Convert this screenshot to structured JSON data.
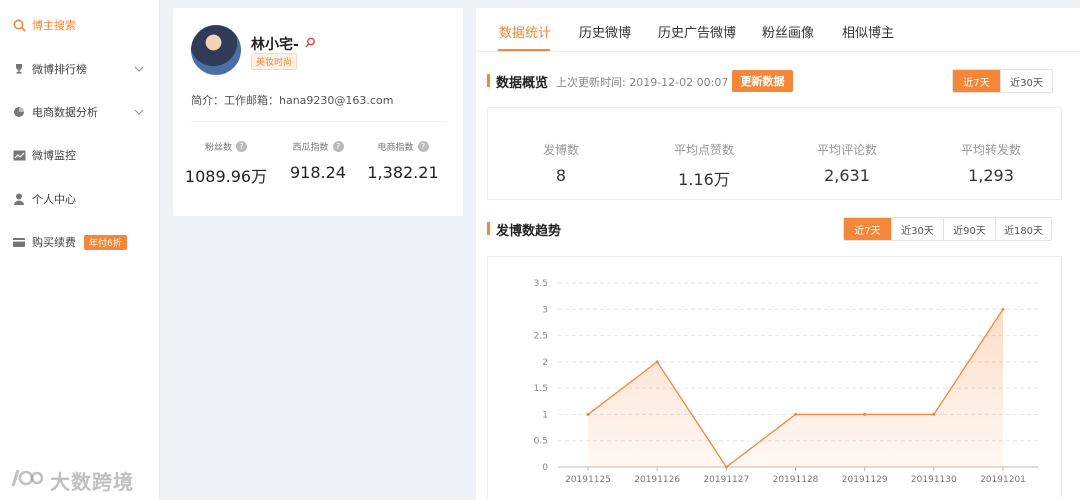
{
  "sidebar": {
    "items": [
      {
        "label": "博主搜索",
        "icon": "search-icon",
        "active": true
      },
      {
        "label": "微博排行榜",
        "icon": "trophy-icon",
        "has_chevron": true
      },
      {
        "label": "电商数据分析",
        "icon": "pie-chart-icon",
        "has_chevron": true
      },
      {
        "label": "微博监控",
        "icon": "monitor-chart-icon"
      },
      {
        "label": "个人中心",
        "icon": "user-icon"
      },
      {
        "label": "购买续费",
        "icon": "card-icon",
        "badge": "年付6折"
      }
    ]
  },
  "watermark": {
    "text": "大数跨境"
  },
  "profile": {
    "name": "林小宅-",
    "tag": "美妆时尚",
    "bio": "简介：工作邮箱：hana9230@163.com",
    "stats": [
      {
        "label": "粉丝数",
        "value": "1089.96万"
      },
      {
        "label": "西瓜指数",
        "value": "918.24"
      },
      {
        "label": "电商指数",
        "value": "1,382.21"
      }
    ]
  },
  "tabs": [
    "数据统计",
    "历史微博",
    "历史广告微博",
    "粉丝画像",
    "相似博主"
  ],
  "overview": {
    "title": "数据概览",
    "updated_label": "上次更新时间: 2019-12-02 00:07",
    "update_button": "更新数据",
    "ranges": [
      "近7天",
      "近30天"
    ],
    "stats": [
      {
        "label": "发博数",
        "value": "8"
      },
      {
        "label": "平均点赞数",
        "value": "1.16万"
      },
      {
        "label": "平均评论数",
        "value": "2,631"
      },
      {
        "label": "平均转发数",
        "value": "1,293"
      }
    ]
  },
  "trend": {
    "title": "发博数趋势",
    "ranges": [
      "近7天",
      "近30天",
      "近90天",
      "近180天"
    ]
  },
  "colors": {
    "accent": "#f5873a"
  },
  "chart_data": {
    "type": "area",
    "x": [
      "20191125",
      "20191126",
      "20191127",
      "20191128",
      "20191129",
      "20191130",
      "20191201"
    ],
    "series": [
      {
        "values": [
          1,
          2,
          0,
          1,
          1,
          1,
          3
        ]
      }
    ],
    "yticks": [
      "0",
      "0.5",
      "1",
      "1.5",
      "2",
      "2.5",
      "3",
      "3.5"
    ],
    "ylim": [
      0,
      3.5
    ],
    "grid": true
  }
}
